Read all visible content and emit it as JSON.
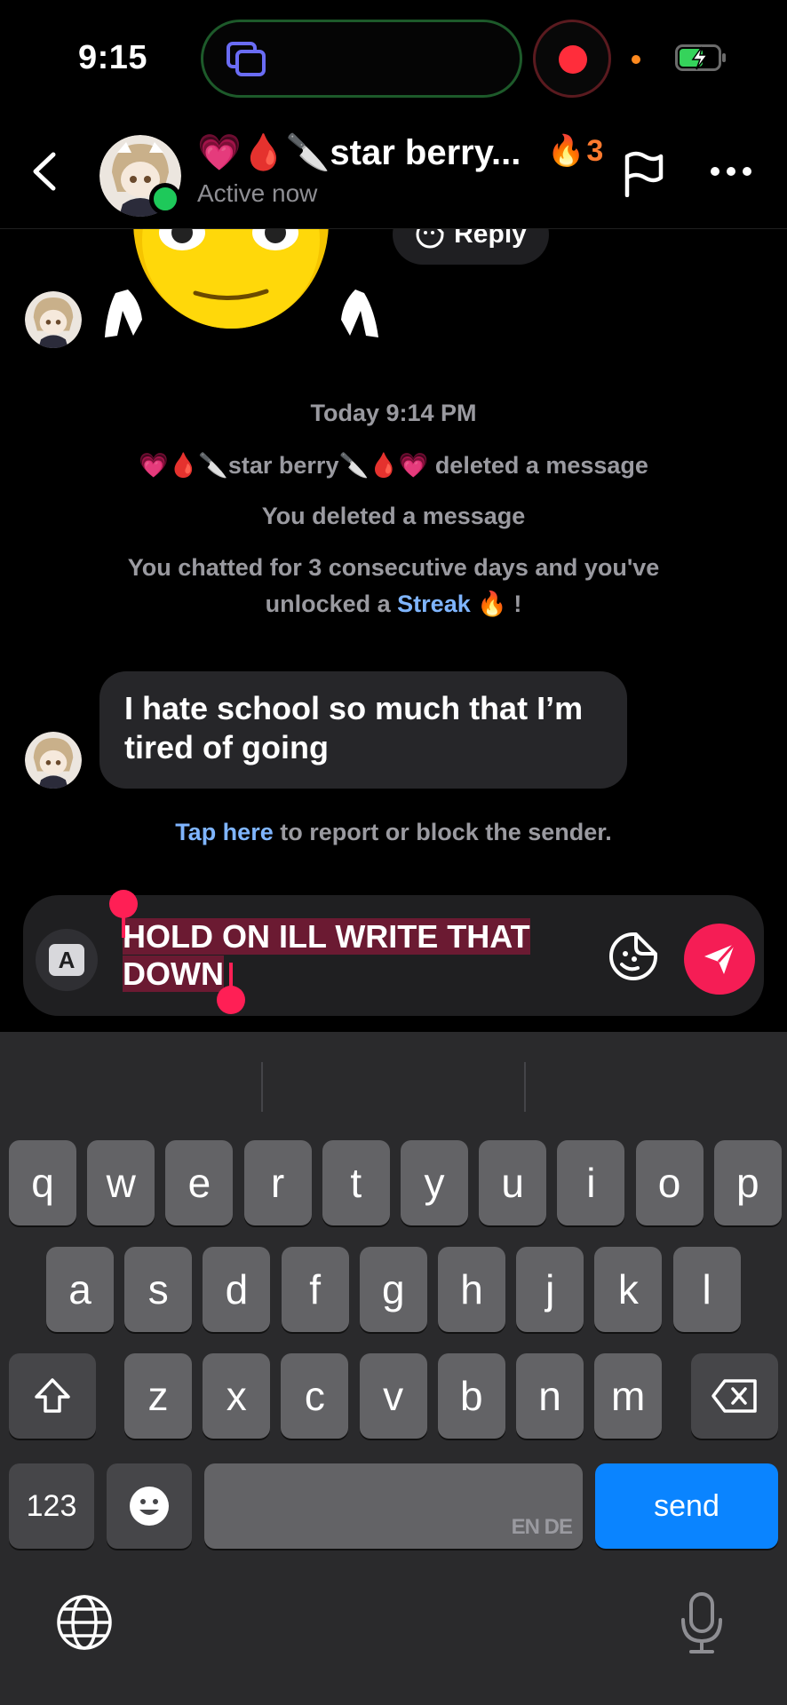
{
  "status_bar": {
    "time": "9:15"
  },
  "chat_header": {
    "contact_name": "💗🩸🔪star berry...",
    "streak_count": "3",
    "status": "Active now"
  },
  "sticker_reply": {
    "label": "Reply"
  },
  "system": {
    "timestamp": "Today 9:14 PM",
    "deleted_by_other_name": "💗🩸🔪star berry🔪🩸💗",
    "deleted_by_other_action": " deleted a message",
    "deleted_by_you": "You deleted a message",
    "streak_line1": "You chatted for 3 consecutive days and you've",
    "streak_line2_pre": "unlocked a ",
    "streak_link": "Streak",
    "streak_line2_post": " 🔥 !"
  },
  "incoming_message": {
    "text": "I hate school so much that I’m tired of going"
  },
  "report": {
    "link": "Tap here",
    "rest": " to report or block the sender."
  },
  "composer": {
    "text": "HOLD ON ILL WRITE THAT DOWN"
  },
  "keyboard": {
    "row1": [
      "q",
      "w",
      "e",
      "r",
      "t",
      "y",
      "u",
      "i",
      "o",
      "p"
    ],
    "row2": [
      "a",
      "s",
      "d",
      "f",
      "g",
      "h",
      "j",
      "k",
      "l"
    ],
    "row3": [
      "z",
      "x",
      "c",
      "v",
      "b",
      "n",
      "m"
    ],
    "numbers_key": "123",
    "space_hint": "EN DE",
    "send_key": "send"
  },
  "colors": {
    "accent_send": "#f51d55",
    "keyboard_send": "#0a84ff",
    "online": "#1ec95a",
    "streak": "#ff7a2e"
  }
}
